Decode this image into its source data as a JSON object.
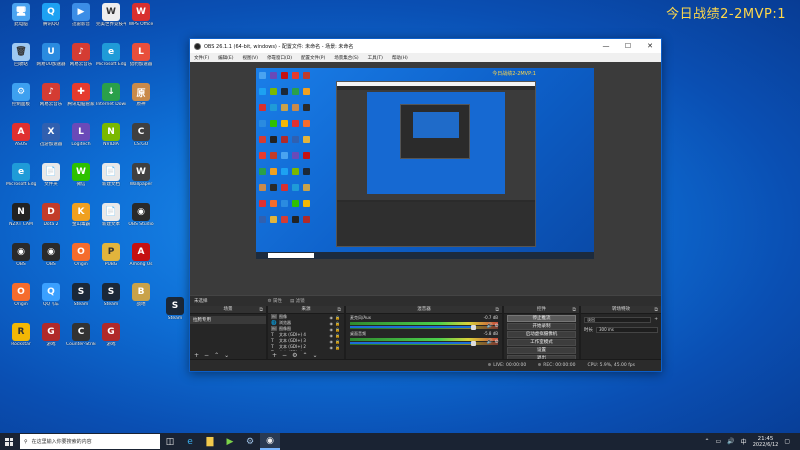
{
  "overlay_text": "今日战绩2-2MVP:1",
  "desktop_icons": [
    {
      "label": "此电脑",
      "color": "#4aa3f0",
      "glyph": "🖥"
    },
    {
      "label": "腾讯QQ",
      "color": "#1da1f2",
      "glyph": "Q"
    },
    {
      "label": "迅雷影音",
      "color": "#3b8de6",
      "glyph": "▶"
    },
    {
      "label": "完美世界竞技平台",
      "color": "#eeeeee",
      "glyph": "W"
    },
    {
      "label": "WPS Office",
      "color": "#d8302f",
      "glyph": "W"
    },
    {
      "label": "回收站",
      "color": "#9ec9f2",
      "glyph": "🗑"
    },
    {
      "label": "网易UU加速器",
      "color": "#2a8be0",
      "glyph": "U"
    },
    {
      "label": "网易云音乐",
      "color": "#d43c33",
      "glyph": "♪"
    },
    {
      "label": "Microsoft Edge",
      "color": "#1f9bd8",
      "glyph": "e"
    },
    {
      "label": "猎豹加速器",
      "color": "#e84f3c",
      "glyph": "L"
    },
    {
      "label": "控制面板",
      "color": "#3da0f0",
      "glyph": "⚙"
    },
    {
      "label": "网易云音乐",
      "color": "#d43c33",
      "glyph": "♪"
    },
    {
      "label": "腾讯电脑管家",
      "color": "#e63b2e",
      "glyph": "✚"
    },
    {
      "label": "Internet Download",
      "color": "#2aa04a",
      "glyph": "↓"
    },
    {
      "label": "原神",
      "color": "#c98a4a",
      "glyph": "原"
    },
    {
      "label": "ASUS",
      "color": "#e03030",
      "glyph": "A"
    },
    {
      "label": "迅游加速器",
      "color": "#3060b0",
      "glyph": "X"
    },
    {
      "label": "Logitech",
      "color": "#6a4ab8",
      "glyph": "L"
    },
    {
      "label": "NVIDIA",
      "color": "#7ab800",
      "glyph": "N"
    },
    {
      "label": "CS:GO",
      "color": "#404040",
      "glyph": "C"
    },
    {
      "label": "Microsoft Edge",
      "color": "#1f9bd8",
      "glyph": "e"
    },
    {
      "label": "文件夹",
      "color": "#e8e8e8",
      "glyph": "📄"
    },
    {
      "label": "微信",
      "color": "#2dc100",
      "glyph": "W"
    },
    {
      "label": "新建文档",
      "color": "#e8e8e8",
      "glyph": "📄"
    },
    {
      "label": "Wallpaper",
      "color": "#404040",
      "glyph": "W"
    },
    {
      "label": "NZXT CAM",
      "color": "#222222",
      "glyph": "N"
    },
    {
      "label": "Dota 2",
      "color": "#c23c2a",
      "glyph": "D"
    },
    {
      "label": "金山毒霸",
      "color": "#f0a020",
      "glyph": "K"
    },
    {
      "label": "新建文本",
      "color": "#e8e8e8",
      "glyph": "📄"
    },
    {
      "label": "OBS Studio",
      "color": "#2a2a2a",
      "glyph": "◉"
    },
    {
      "label": "OBS",
      "color": "#2a2a2a",
      "glyph": "◉"
    },
    {
      "label": "OBS",
      "color": "#2a2a2a",
      "glyph": "◉"
    },
    {
      "label": "Origin",
      "color": "#f56c2d",
      "glyph": "O"
    },
    {
      "label": "PUBG",
      "color": "#e2b43c",
      "glyph": "P"
    },
    {
      "label": "Among Us",
      "color": "#c51111",
      "glyph": "A"
    },
    {
      "label": "Origin",
      "color": "#f56c2d",
      "glyph": "O"
    },
    {
      "label": "QQ飞车",
      "color": "#3aa0ff",
      "glyph": "Q"
    },
    {
      "label": "Steam",
      "color": "#1b2838",
      "glyph": "S"
    },
    {
      "label": "Steam",
      "color": "#1b2838",
      "glyph": "S"
    },
    {
      "label": "战地",
      "color": "#c9a24a",
      "glyph": "B"
    },
    {
      "label": "Rockstar",
      "color": "#f2b705",
      "glyph": "R"
    },
    {
      "label": "游戏",
      "color": "#b02a2a",
      "glyph": "G"
    },
    {
      "label": "Counter-Strike",
      "color": "#333333",
      "glyph": "C"
    },
    {
      "label": "游戏",
      "color": "#b02a2a",
      "glyph": "G"
    }
  ],
  "obs": {
    "title": "OBS 26.1.1 (64-bit, windows) - 配置文件: 未命名 - 场景: 未命名",
    "menu": [
      "文件(F)",
      "编辑(E)",
      "视图(V)",
      "停靠窗口(D)",
      "配置文件(P)",
      "场景集合(S)",
      "工具(T)",
      "帮助(H)"
    ],
    "canvas_overlay": "今日战绩2-2MVP:1",
    "scene_status": "未选择",
    "toolbar_props": "属性",
    "toolbar_filters": "滤镜",
    "docks": {
      "scenes": "场景",
      "sources": "来源",
      "mixer": "混音器",
      "controls": "控件",
      "transitions": "转场特效"
    },
    "scene_items": [
      "拉胯专用"
    ],
    "sources": [
      {
        "icon": "image",
        "glyph": "🖼",
        "label": "图像"
      },
      {
        "icon": "browser",
        "glyph": "🌐",
        "label": "浏览器"
      },
      {
        "icon": "image",
        "glyph": "🖼",
        "label": "图像图"
      },
      {
        "icon": "text",
        "glyph": "T",
        "label": "文本 (GDI+) 4"
      },
      {
        "icon": "text",
        "glyph": "T",
        "label": "文本 (GDI+) 3"
      },
      {
        "icon": "text",
        "glyph": "T",
        "label": "文本 (GDI+) 2"
      },
      {
        "icon": "text",
        "glyph": "T",
        "label": "文本 (GDI+)"
      },
      {
        "icon": "video",
        "glyph": "🎥",
        "label": "视频捕获设备"
      }
    ],
    "mixer": [
      {
        "name": "麦克风/Aux",
        "db": "-0.7 dB"
      },
      {
        "name": "桌面音频",
        "db": "-5.8 dB"
      }
    ],
    "controls": {
      "stop_stream": "停止推流",
      "start_record": "开始录制",
      "virtual_cam": "启动虚拟摄像机",
      "studio_mode": "工作室模式",
      "settings": "设置",
      "exit": "退出"
    },
    "transitions": {
      "type": "淡出",
      "duration_label": "时长",
      "duration": "300 ms"
    },
    "status": {
      "live_label": "LIVE:",
      "live_time": "00:00:00",
      "rec_label": "REC:",
      "rec_time": "00:00:00",
      "cpu": "CPU: 5.9%, 45.00 fps"
    }
  },
  "taskbar": {
    "search_placeholder": "在这里输入你要搜索的内容",
    "apps": [
      "edge-icon",
      "explorer-icon",
      "media-icon",
      "steam-icon",
      "obs-icon"
    ],
    "lang": "中",
    "time": "21:45",
    "date": "2022/6/12"
  }
}
